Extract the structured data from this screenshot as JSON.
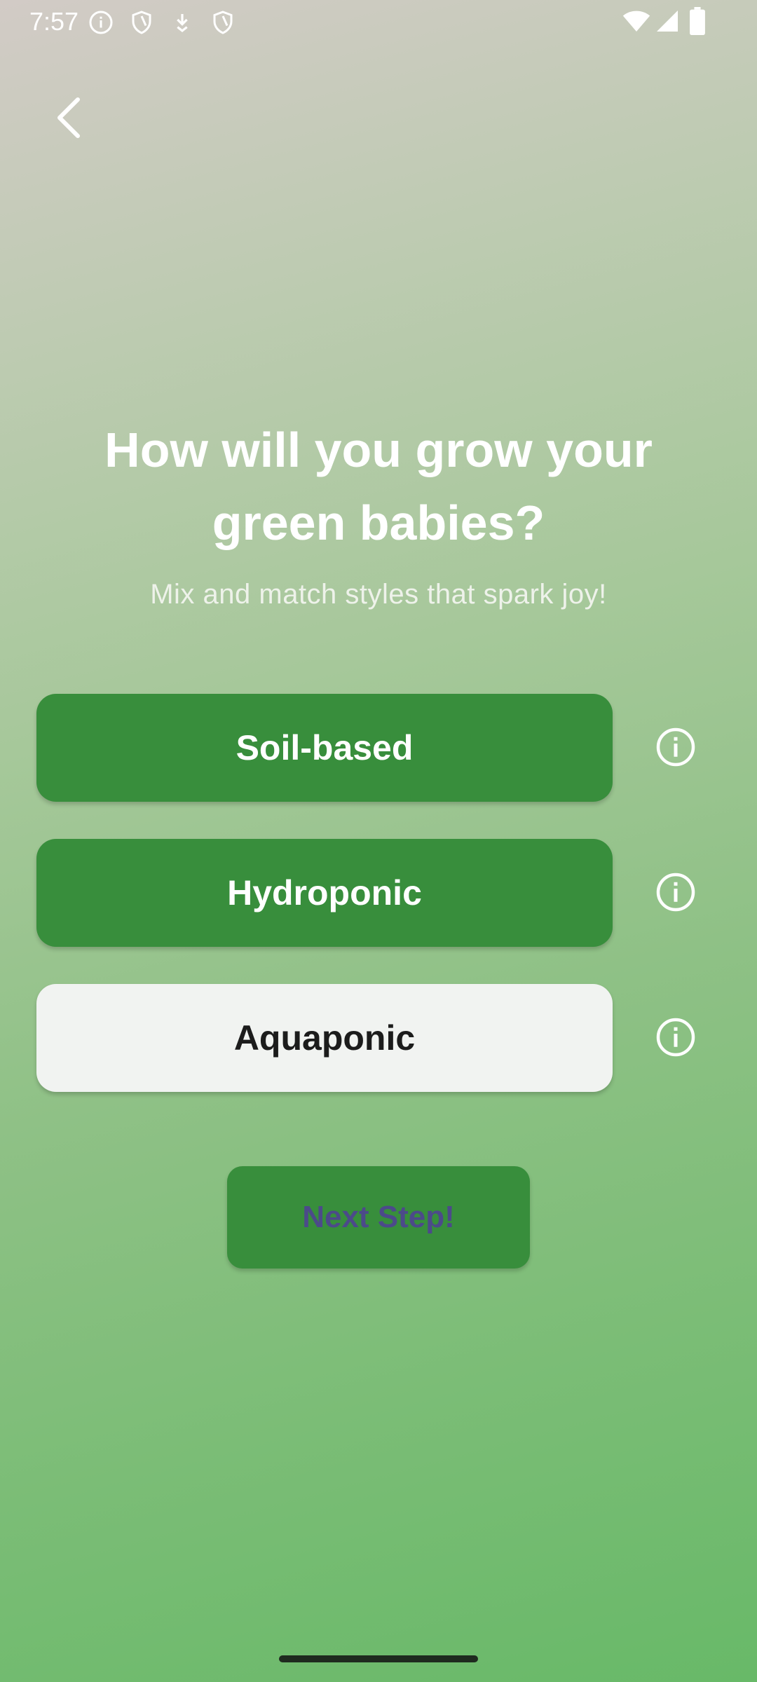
{
  "status_bar": {
    "time": "7:57",
    "left_icons": [
      "info-circle-icon",
      "shield-icon",
      "download-icon",
      "shield-icon"
    ],
    "right_icons": [
      "wifi-icon",
      "signal-icon",
      "battery-icon"
    ]
  },
  "header": {
    "back_icon": "chevron-left-icon"
  },
  "main": {
    "title": "How will you grow your green babies?",
    "subtitle": "Mix and match styles that spark joy!",
    "options": [
      {
        "label": "Soil-based",
        "selected": true
      },
      {
        "label": "Hydroponic",
        "selected": true
      },
      {
        "label": "Aquaponic",
        "selected": false
      }
    ],
    "info_icon": "info-circle-icon",
    "next_label": "Next Step!"
  },
  "colors": {
    "selected_bg": "#388e3c",
    "unselected_bg": "#f1f3f1",
    "next_text": "#4c4a8a"
  }
}
